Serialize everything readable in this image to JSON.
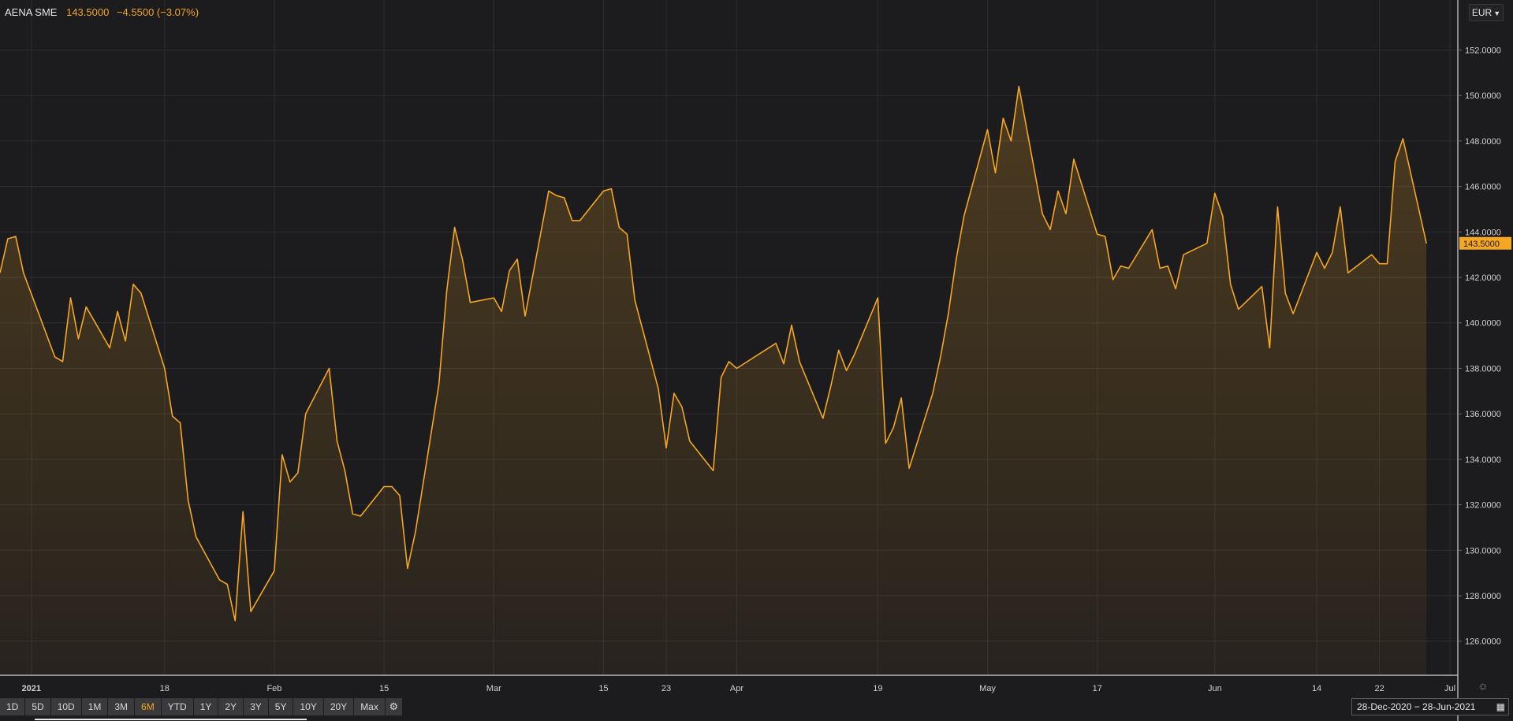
{
  "header": {
    "ticker": "AENA SME",
    "price": "143.5000",
    "change": "−4.5500 (−3.07%)"
  },
  "currency": {
    "label": "EUR",
    "chevron_icon": "chevron-down-icon"
  },
  "toolbar": {
    "buttons": [
      "1D",
      "5D",
      "10D",
      "1M",
      "3M",
      "6M",
      "YTD",
      "1Y",
      "2Y",
      "3Y",
      "5Y",
      "10Y",
      "20Y",
      "Max"
    ],
    "active": "6M",
    "settings_icon": "gear-icon"
  },
  "date_range": {
    "label": "28-Dec-2020 − 28-Jun-2021",
    "icon": "calendar-icon"
  },
  "colors": {
    "line": "#f5a623",
    "background": "#1c1c1e",
    "grid": "#2e2e31",
    "axis": "#d0d0d0"
  },
  "chart_data": {
    "type": "area",
    "title": "",
    "xlabel": "",
    "ylabel": "",
    "ylim": [
      124.5,
      154.2
    ],
    "yticks": [
      126,
      128,
      130,
      132,
      134,
      136,
      138,
      140,
      142,
      144,
      146,
      148,
      150,
      152
    ],
    "ytick_labels": [
      "126.0000",
      "128.0000",
      "130.0000",
      "132.0000",
      "134.0000",
      "136.0000",
      "138.0000",
      "140.0000",
      "142.0000",
      "144.0000",
      "146.0000",
      "148.0000",
      "150.0000",
      "152.0000"
    ],
    "current_value": 143.5,
    "current_label": "143.5000",
    "grid": true,
    "x_start": "2020-12-28",
    "x_end": "2021-07-02",
    "xticks": [
      {
        "date": "2021-01-01",
        "label": "2021",
        "bold": true
      },
      {
        "date": "2021-01-18",
        "label": "18"
      },
      {
        "date": "2021-02-01",
        "label": "Feb"
      },
      {
        "date": "2021-02-15",
        "label": "15"
      },
      {
        "date": "2021-03-01",
        "label": "Mar"
      },
      {
        "date": "2021-03-15",
        "label": "15"
      },
      {
        "date": "2021-03-23",
        "label": "23"
      },
      {
        "date": "2021-04-01",
        "label": "Apr"
      },
      {
        "date": "2021-04-19",
        "label": "19"
      },
      {
        "date": "2021-05-03",
        "label": "May"
      },
      {
        "date": "2021-05-17",
        "label": "17"
      },
      {
        "date": "2021-06-01",
        "label": "Jun"
      },
      {
        "date": "2021-06-14",
        "label": "14"
      },
      {
        "date": "2021-06-22",
        "label": "22"
      },
      {
        "date": "2021-07-01",
        "label": "Jul"
      }
    ],
    "series": [
      {
        "values": [
          [
            "2020-12-28",
            142.2
          ],
          [
            "2020-12-29",
            143.7
          ],
          [
            "2020-12-30",
            143.8
          ],
          [
            "2020-12-31",
            142.2
          ],
          [
            "2021-01-04",
            138.5
          ],
          [
            "2021-01-05",
            138.3
          ],
          [
            "2021-01-06",
            141.1
          ],
          [
            "2021-01-07",
            139.3
          ],
          [
            "2021-01-08",
            140.7
          ],
          [
            "2021-01-11",
            138.9
          ],
          [
            "2021-01-12",
            140.5
          ],
          [
            "2021-01-13",
            139.2
          ],
          [
            "2021-01-14",
            141.7
          ],
          [
            "2021-01-15",
            141.3
          ],
          [
            "2021-01-18",
            138.0
          ],
          [
            "2021-01-19",
            135.9
          ],
          [
            "2021-01-20",
            135.6
          ],
          [
            "2021-01-21",
            132.2
          ],
          [
            "2021-01-22",
            130.6
          ],
          [
            "2021-01-25",
            128.7
          ],
          [
            "2021-01-26",
            128.5
          ],
          [
            "2021-01-27",
            126.9
          ],
          [
            "2021-01-28",
            131.7
          ],
          [
            "2021-01-29",
            127.3
          ],
          [
            "2021-02-01",
            129.1
          ],
          [
            "2021-02-02",
            134.2
          ],
          [
            "2021-02-03",
            133.0
          ],
          [
            "2021-02-04",
            133.4
          ],
          [
            "2021-02-05",
            136.0
          ],
          [
            "2021-02-08",
            138.0
          ],
          [
            "2021-02-09",
            134.8
          ],
          [
            "2021-02-10",
            133.5
          ],
          [
            "2021-02-11",
            131.6
          ],
          [
            "2021-02-12",
            131.5
          ],
          [
            "2021-02-15",
            132.8
          ],
          [
            "2021-02-16",
            132.8
          ],
          [
            "2021-02-17",
            132.4
          ],
          [
            "2021-02-18",
            129.2
          ],
          [
            "2021-02-19",
            130.8
          ],
          [
            "2021-02-22",
            137.3
          ],
          [
            "2021-02-23",
            141.4
          ],
          [
            "2021-02-24",
            144.2
          ],
          [
            "2021-02-25",
            142.8
          ],
          [
            "2021-02-26",
            140.9
          ],
          [
            "2021-03-01",
            141.1
          ],
          [
            "2021-03-02",
            140.5
          ],
          [
            "2021-03-03",
            142.3
          ],
          [
            "2021-03-04",
            142.8
          ],
          [
            "2021-03-05",
            140.3
          ],
          [
            "2021-03-08",
            145.8
          ],
          [
            "2021-03-09",
            145.6
          ],
          [
            "2021-03-10",
            145.5
          ],
          [
            "2021-03-11",
            144.5
          ],
          [
            "2021-03-12",
            144.5
          ],
          [
            "2021-03-15",
            145.8
          ],
          [
            "2021-03-16",
            145.9
          ],
          [
            "2021-03-17",
            144.2
          ],
          [
            "2021-03-18",
            143.9
          ],
          [
            "2021-03-19",
            141.0
          ],
          [
            "2021-03-22",
            137.1
          ],
          [
            "2021-03-23",
            134.5
          ],
          [
            "2021-03-24",
            136.9
          ],
          [
            "2021-03-25",
            136.3
          ],
          [
            "2021-03-26",
            134.8
          ],
          [
            "2021-03-29",
            133.5
          ],
          [
            "2021-03-30",
            137.6
          ],
          [
            "2021-03-31",
            138.3
          ],
          [
            "2021-04-01",
            138.0
          ],
          [
            "2021-04-06",
            139.1
          ],
          [
            "2021-04-07",
            138.2
          ],
          [
            "2021-04-08",
            139.9
          ],
          [
            "2021-04-09",
            138.3
          ],
          [
            "2021-04-12",
            135.8
          ],
          [
            "2021-04-13",
            137.2
          ],
          [
            "2021-04-14",
            138.8
          ],
          [
            "2021-04-15",
            137.9
          ],
          [
            "2021-04-16",
            138.6
          ],
          [
            "2021-04-19",
            141.1
          ],
          [
            "2021-04-20",
            134.7
          ],
          [
            "2021-04-21",
            135.4
          ],
          [
            "2021-04-22",
            136.7
          ],
          [
            "2021-04-23",
            133.6
          ],
          [
            "2021-04-26",
            136.9
          ],
          [
            "2021-04-27",
            138.5
          ],
          [
            "2021-04-28",
            140.4
          ],
          [
            "2021-04-29",
            142.8
          ],
          [
            "2021-04-30",
            144.7
          ],
          [
            "2021-05-03",
            148.5
          ],
          [
            "2021-05-04",
            146.6
          ],
          [
            "2021-05-05",
            149.0
          ],
          [
            "2021-05-06",
            148.0
          ],
          [
            "2021-05-07",
            150.4
          ],
          [
            "2021-05-10",
            144.8
          ],
          [
            "2021-05-11",
            144.1
          ],
          [
            "2021-05-12",
            145.8
          ],
          [
            "2021-05-13",
            144.8
          ],
          [
            "2021-05-14",
            147.2
          ],
          [
            "2021-05-17",
            143.9
          ],
          [
            "2021-05-18",
            143.8
          ],
          [
            "2021-05-19",
            141.9
          ],
          [
            "2021-05-20",
            142.5
          ],
          [
            "2021-05-21",
            142.4
          ],
          [
            "2021-05-24",
            144.1
          ],
          [
            "2021-05-25",
            142.4
          ],
          [
            "2021-05-26",
            142.5
          ],
          [
            "2021-05-27",
            141.5
          ],
          [
            "2021-05-28",
            143.0
          ],
          [
            "2021-05-31",
            143.5
          ],
          [
            "2021-06-01",
            145.7
          ],
          [
            "2021-06-02",
            144.7
          ],
          [
            "2021-06-03",
            141.7
          ],
          [
            "2021-06-04",
            140.6
          ],
          [
            "2021-06-07",
            141.6
          ],
          [
            "2021-06-08",
            138.9
          ],
          [
            "2021-06-09",
            145.1
          ],
          [
            "2021-06-10",
            141.3
          ],
          [
            "2021-06-11",
            140.4
          ],
          [
            "2021-06-14",
            143.1
          ],
          [
            "2021-06-15",
            142.4
          ],
          [
            "2021-06-16",
            143.1
          ],
          [
            "2021-06-17",
            145.1
          ],
          [
            "2021-06-18",
            142.2
          ],
          [
            "2021-06-21",
            143.0
          ],
          [
            "2021-06-22",
            142.6
          ],
          [
            "2021-06-23",
            142.6
          ],
          [
            "2021-06-24",
            147.1
          ],
          [
            "2021-06-25",
            148.1
          ],
          [
            "2021-06-28",
            143.5
          ]
        ]
      }
    ]
  }
}
